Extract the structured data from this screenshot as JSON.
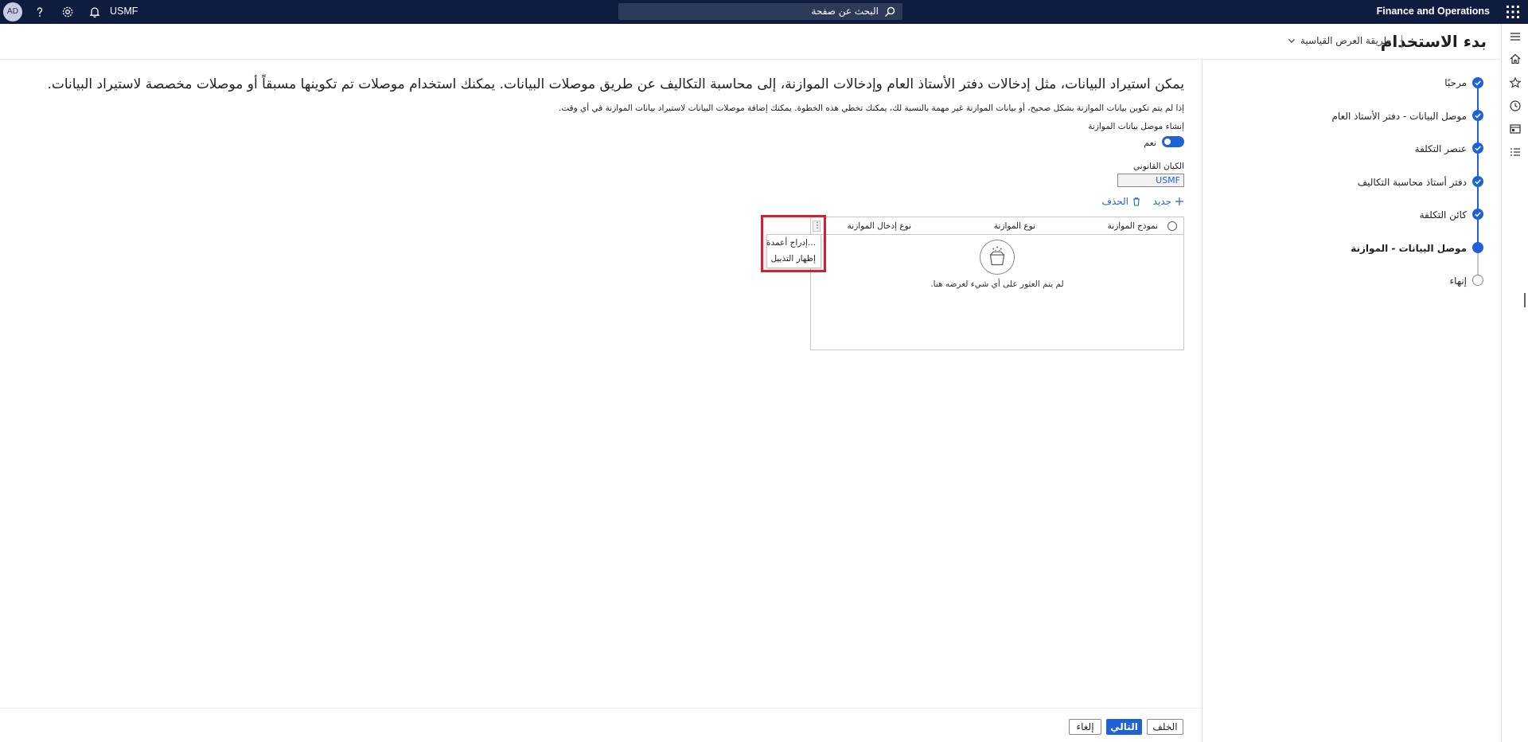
{
  "app": {
    "title": "Finance and Operations",
    "search_placeholder": "البحث عن صفحة",
    "company": "USMF",
    "avatar_initials": "AD",
    "brand_color": "#0f1c3f",
    "accent_color": "#1f62d7"
  },
  "page": {
    "title": "بدء الاستخدام",
    "view_mode": "طريقة العرض القياسية"
  },
  "steps": [
    {
      "label": "مرحبًا",
      "status": "done"
    },
    {
      "label": "موصل البيانات - دفتر الأستاذ العام",
      "status": "done"
    },
    {
      "label": "عنصر التكلفة",
      "status": "done"
    },
    {
      "label": "دفتر أستاذ محاسبة التكاليف",
      "status": "done"
    },
    {
      "label": "كائن التكلفة",
      "status": "done"
    },
    {
      "label": "موصل البيانات - الموازنة",
      "status": "current"
    },
    {
      "label": "إنهاء",
      "status": "todo"
    }
  ],
  "content": {
    "intro_title": "يمكن استيراد البيانات، مثل إدخالات دفتر الأستاذ العام وإدخالات الموازنة، إلى محاسبة التكاليف عن طريق موصلات البيانات. يمكنك استخدام موصلات تم تكوينها مسبقاً أو موصلات مخصصة لاستيراد البيانات.",
    "intro_sub": "إذا لم يتم تكوين بيانات الموازنة بشكل صحيح، أو بيانات الموازنة غير مهمة بالنسبة لك، يمكنك تخطي هذه الخطوة. يمكنك إضافة موصلات البيانات لاستيراد بيانات الموازنة في أي وقت.",
    "toggle_label": "إنشاء موصل بيانات الموازنة",
    "toggle_value": "نعم",
    "entity_label": "الكيان القانوني",
    "entity_value": "USMF",
    "new_label": "جديد",
    "delete_label": "الحذف"
  },
  "grid": {
    "columns": [
      "نموذج الموازنة",
      "نوع الموازنة",
      "نوع إدخال الموازنة"
    ],
    "empty_text": "لم يتم العثور على أي شيء لعرضه هنا.",
    "more_glyph": "⋮"
  },
  "context_menu": {
    "items": [
      "إدراج أعمدة...",
      "إظهار التذييل"
    ]
  },
  "footer": {
    "back_label": "الخلف",
    "next_label": "التالي",
    "cancel_label": "إلغاء"
  }
}
